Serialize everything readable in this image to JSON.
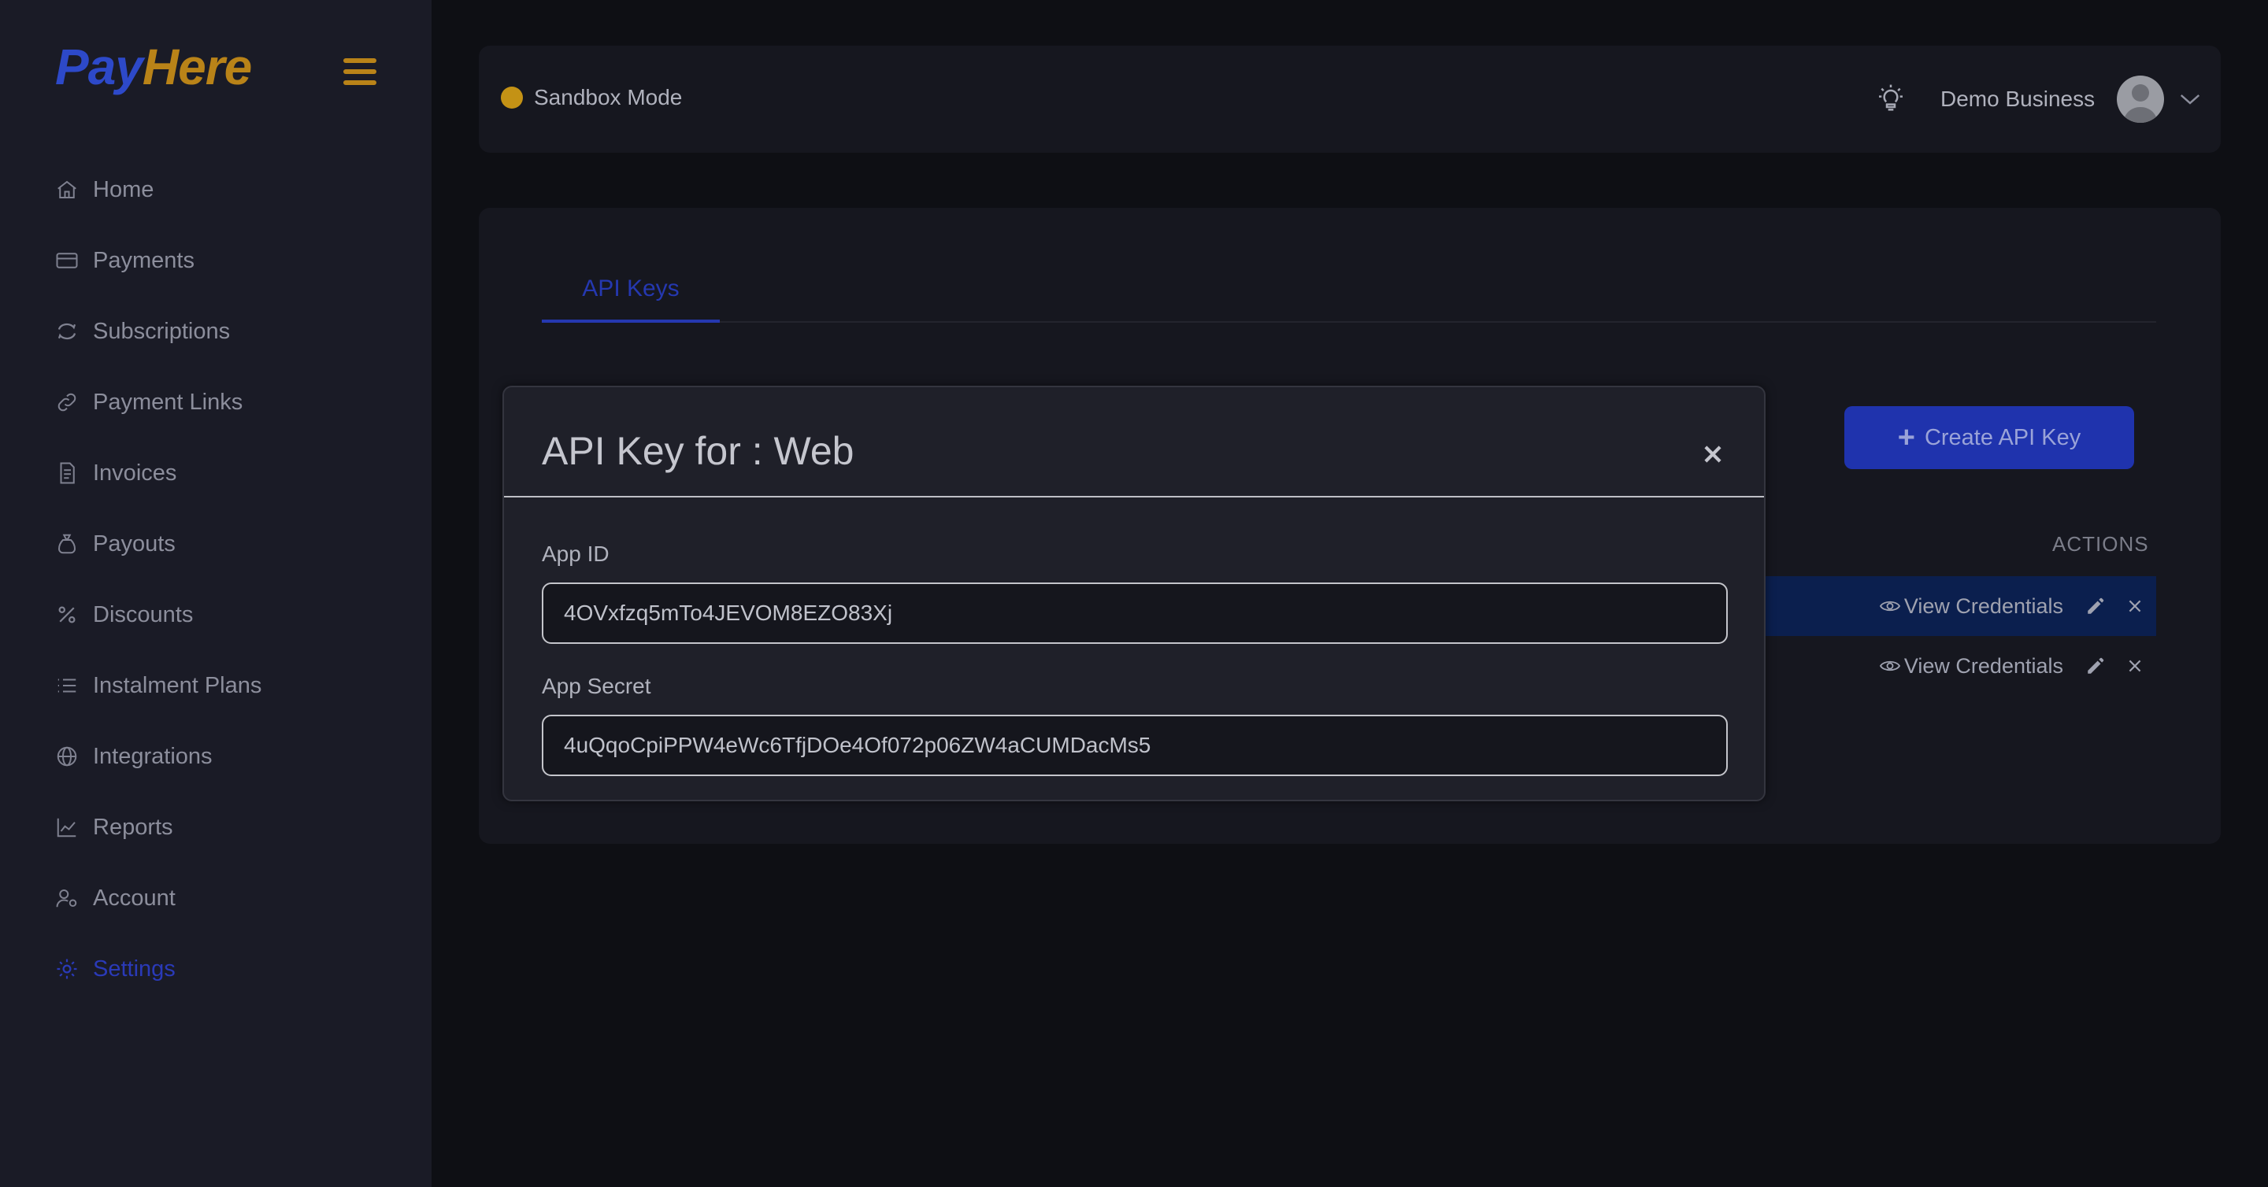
{
  "brand": {
    "logo_pay": "Pay",
    "logo_here": "Here"
  },
  "sidebar": {
    "items": [
      {
        "label": "Home",
        "icon": "home-icon"
      },
      {
        "label": "Payments",
        "icon": "credit-card-icon"
      },
      {
        "label": "Subscriptions",
        "icon": "refresh-icon"
      },
      {
        "label": "Payment Links",
        "icon": "link-icon"
      },
      {
        "label": "Invoices",
        "icon": "invoice-icon"
      },
      {
        "label": "Payouts",
        "icon": "money-bag-icon"
      },
      {
        "label": "Discounts",
        "icon": "percent-icon"
      },
      {
        "label": "Instalment Plans",
        "icon": "list-icon"
      },
      {
        "label": "Integrations",
        "icon": "globe-icon"
      },
      {
        "label": "Reports",
        "icon": "chart-line-icon"
      },
      {
        "label": "Account",
        "icon": "user-gear-icon"
      },
      {
        "label": "Settings",
        "icon": "gear-icon",
        "active": true
      }
    ]
  },
  "header": {
    "mode_label": "Sandbox Mode",
    "business_name": "Demo Business"
  },
  "main": {
    "tabs": [
      {
        "label": "API Keys",
        "active": true
      }
    ],
    "create_button_label": "Create API Key",
    "table": {
      "actions_header": "ACTIONS",
      "rows": [
        {
          "view_label": "View Credentials",
          "highlighted": true
        },
        {
          "view_label": "View Credentials",
          "highlighted": false
        }
      ]
    }
  },
  "modal": {
    "title": "API Key for : Web",
    "app_id_label": "App ID",
    "app_id_value": "4OVxfzq5mTo4JEVOM8EZO83Xj",
    "app_secret_label": "App Secret",
    "app_secret_value": "4uQqoCpiPPW4eWc6TfjDOe4Of072p06ZW4aCUMDacMs5"
  },
  "colors": {
    "brand_blue": "#2d49c9",
    "brand_gold": "#b98318",
    "sandbox_dot": "#c49215",
    "active_nav": "#2a3ab8",
    "primary_button": "#1f33ad"
  }
}
